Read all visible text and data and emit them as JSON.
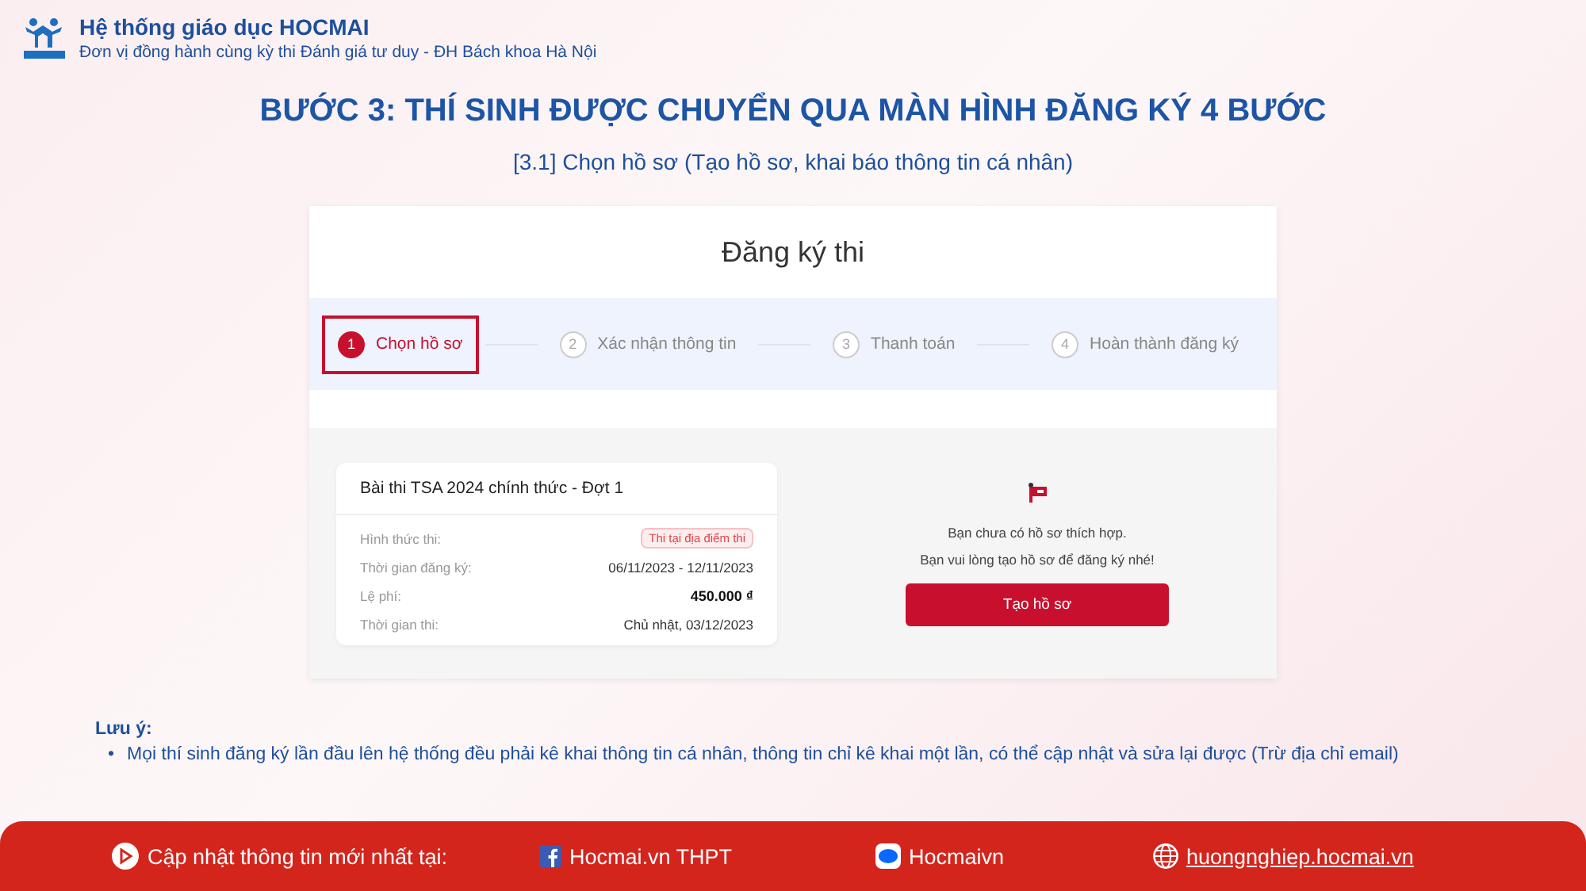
{
  "header": {
    "brand": "Hệ thống giáo dục HOCMAI",
    "tagline": "Đơn vị đồng hành cùng kỳ thi Đánh giá tư duy - ĐH Bách khoa Hà Nội"
  },
  "title": "BƯỚC 3: THÍ SINH ĐƯỢC CHUYỂN QUA MÀN HÌNH ĐĂNG KÝ 4 BƯỚC",
  "subtitle": "[3.1] Chọn hồ sơ (Tạo hồ sơ, khai báo thông tin cá nhân)",
  "screen": {
    "heading": "Đăng ký thi",
    "steps": [
      {
        "number": "1",
        "label": "Chọn hồ sơ",
        "selected": true
      },
      {
        "number": "2",
        "label": "Xác nhận thông tin",
        "selected": false
      },
      {
        "number": "3",
        "label": "Thanh toán",
        "selected": false
      },
      {
        "number": "4",
        "label": "Hoàn thành đăng ký",
        "selected": false
      }
    ],
    "exam": {
      "title": "Bài thi TSA 2024 chính thức - Đợt 1",
      "rows": [
        {
          "label": "Hình thức thi:",
          "value": "Thi tại địa điểm thi",
          "kind": "tag"
        },
        {
          "label": "Thời gian đăng ký:",
          "value": "06/11/2023 - 12/11/2023",
          "kind": "text"
        },
        {
          "label": "Lệ phí:",
          "value": "450.000 ₫",
          "kind": "price"
        },
        {
          "label": "Thời gian thi:",
          "value": "Chủ nhật, 03/12/2023",
          "kind": "text"
        }
      ]
    },
    "empty": {
      "lines": [
        "Bạn chưa có hồ sơ thích hợp.",
        "Bạn vui lòng tạo hồ sơ để đăng ký nhé!"
      ],
      "button": "Tạo hồ sơ"
    }
  },
  "note": {
    "label": "Lưu ý:",
    "items": [
      {
        "bullet": "•",
        "text": "Mọi thí sinh đăng ký lần đầu lên hệ thống đều phải kê khai thông tin cá nhân, thông tin chỉ kê khai một lần, có thể cập nhật và sửa lại được (Trừ địa chỉ email)"
      }
    ]
  },
  "footer": [
    {
      "kind": "play",
      "text": "Cập nhật thông tin mới nhất tại:"
    },
    {
      "kind": "facebook",
      "text": "Hocmai.vn THPT"
    },
    {
      "kind": "zalo",
      "text": "Hocmaivn"
    },
    {
      "kind": "website",
      "text": "huongnghiep.hocmai.vn"
    }
  ]
}
